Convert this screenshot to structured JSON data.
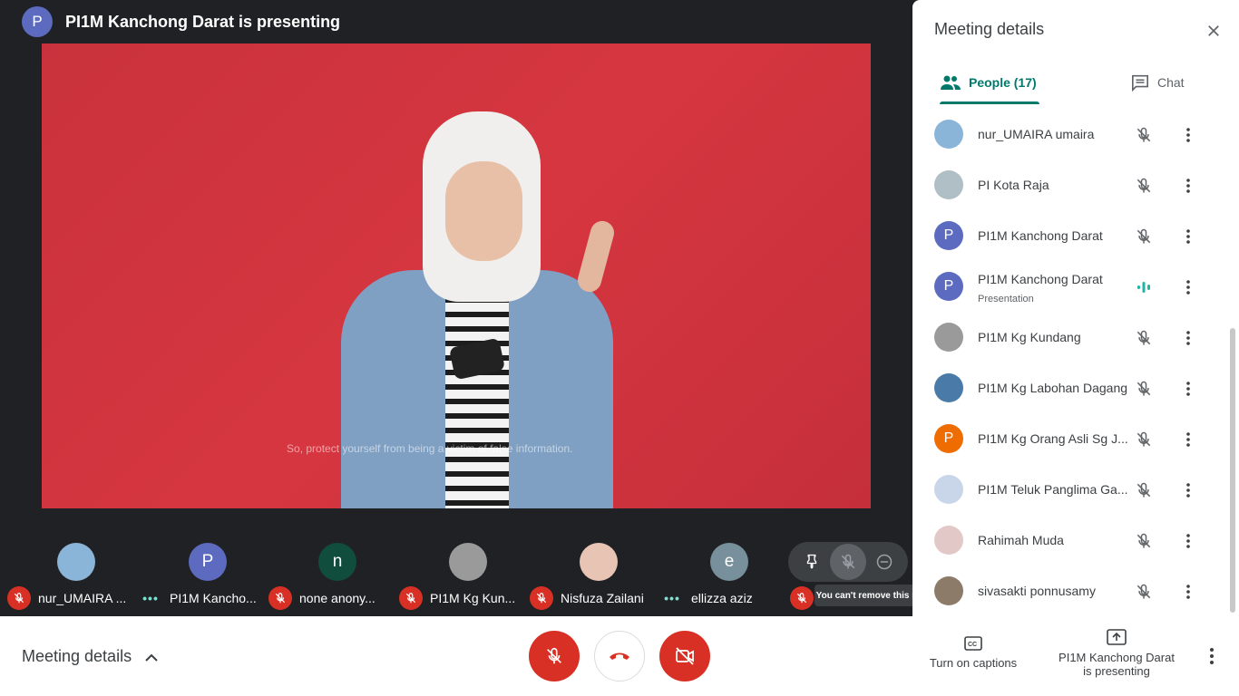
{
  "header": {
    "presenter_initial": "P",
    "presenter_text": "PI1M Kanchong Darat is presenting",
    "avatar_color": "#5c6bc0"
  },
  "video": {
    "subtitle": "So, protect yourself from being a victim of false information."
  },
  "tiles": [
    {
      "name": "nur_UMAIRA ...",
      "status": "muted",
      "avatar_type": "photo",
      "initial": "",
      "color": "#8ab4d8"
    },
    {
      "name": "PI1M Kancho...",
      "status": "speaking",
      "avatar_type": "letter",
      "initial": "P",
      "color": "#5c6bc0"
    },
    {
      "name": "none anony...",
      "status": "muted",
      "avatar_type": "letter",
      "initial": "n",
      "color": "#114d3c"
    },
    {
      "name": "PI1M Kg Kun...",
      "status": "muted",
      "avatar_type": "photo",
      "initial": "",
      "color": "#9a9a9a"
    },
    {
      "name": "Nisfuza Zailani",
      "status": "muted",
      "avatar_type": "photo",
      "initial": "",
      "color": "#e7c4b4"
    },
    {
      "name": "ellizza aziz",
      "status": "speaking",
      "avatar_type": "letter",
      "initial": "e",
      "color": "#78909c"
    }
  ],
  "tooltip": "You can't remove this participant",
  "panel": {
    "title": "Meeting details",
    "tab_people": "People (17)",
    "tab_chat": "Chat",
    "accent": "#00796b",
    "people": [
      {
        "name": "nur_UMAIRA umaira",
        "sub": "",
        "avatar_type": "photo",
        "initial": "",
        "color": "#8ab4d8",
        "mic": "off"
      },
      {
        "name": "PI Kota Raja",
        "sub": "",
        "avatar_type": "photo",
        "initial": "",
        "color": "#b0bec5",
        "mic": "off"
      },
      {
        "name": "PI1M Kanchong Darat",
        "sub": "",
        "avatar_type": "letter",
        "initial": "P",
        "color": "#5c6bc0",
        "mic": "off"
      },
      {
        "name": "PI1M Kanchong Darat",
        "sub": "Presentation",
        "avatar_type": "letter",
        "initial": "P",
        "color": "#5c6bc0",
        "mic": "speaking"
      },
      {
        "name": "PI1M Kg Kundang",
        "sub": "",
        "avatar_type": "photo",
        "initial": "",
        "color": "#9a9a9a",
        "mic": "off"
      },
      {
        "name": "PI1M Kg Labohan Dagang",
        "sub": "",
        "avatar_type": "photo",
        "initial": "",
        "color": "#4a7aa8",
        "mic": "off"
      },
      {
        "name": "PI1M Kg Orang Asli Sg J...",
        "sub": "",
        "avatar_type": "letter",
        "initial": "P",
        "color": "#ef6c00",
        "mic": "off"
      },
      {
        "name": "PI1M Teluk Panglima Ga...",
        "sub": "",
        "avatar_type": "photo",
        "initial": "",
        "color": "#c9d6ea",
        "mic": "off"
      },
      {
        "name": "Rahimah Muda",
        "sub": "",
        "avatar_type": "photo",
        "initial": "",
        "color": "#e3c8c8",
        "mic": "off"
      },
      {
        "name": "sivasakti ponnusamy",
        "sub": "",
        "avatar_type": "photo",
        "initial": "",
        "color": "#8d7b6a",
        "mic": "off"
      }
    ]
  },
  "bottom": {
    "meeting_details": "Meeting details",
    "captions": "Turn on captions",
    "presenting_line1": "PI1M Kanchong Darat",
    "presenting_line2": "is presenting",
    "danger_color": "#d93025"
  }
}
